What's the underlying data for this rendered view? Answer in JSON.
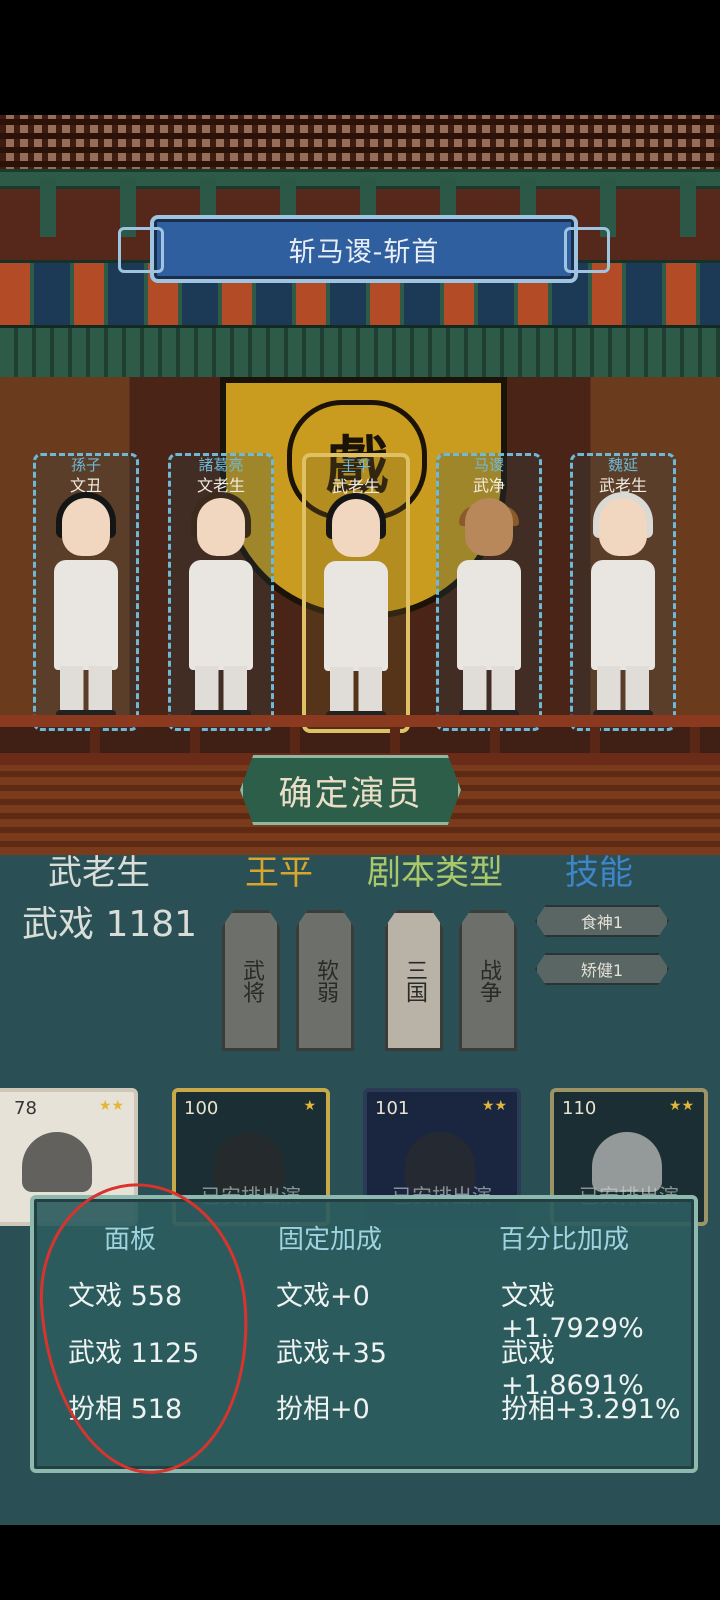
{
  "play_title": "斩马谡-斩首",
  "stage_sign": "戲",
  "actors": [
    {
      "name": "孫子",
      "role": "文丑",
      "selected": false
    },
    {
      "name": "諸葛亮",
      "role": "文老生",
      "selected": false
    },
    {
      "name": "王平",
      "role": "武老生",
      "selected": true
    },
    {
      "name": "马谡",
      "role": "武净",
      "selected": false
    },
    {
      "name": "魏延",
      "role": "武老生",
      "selected": false
    }
  ],
  "confirm_button": "确定演员",
  "info": {
    "role_type": "武老生",
    "actor_name": "王平",
    "script_type_label": "剧本类型",
    "skill_label": "技能",
    "stat_line": "武戏 1181",
    "traits": [
      "武将",
      "软弱"
    ],
    "script_tags": [
      "三国",
      "战争"
    ],
    "skills": [
      "食神1",
      "矫健1"
    ]
  },
  "cards": [
    {
      "level": "78",
      "stars": "★★",
      "note": ""
    },
    {
      "level": "100",
      "stars": "★",
      "note": "已安排出演"
    },
    {
      "level": "101",
      "stars": "★★",
      "note": "已安排出演"
    },
    {
      "level": "110",
      "stars": "★★",
      "note": "已安排出演"
    }
  ],
  "stats_panel": {
    "headers": [
      "面板",
      "固定加成",
      "百分比加成"
    ],
    "panel": [
      "文戏 558",
      "武戏 1125",
      "扮相 518"
    ],
    "fixed": [
      "文戏+0",
      "武戏+35",
      "扮相+0"
    ],
    "percent": [
      "文戏+1.7929%",
      "武戏+1.8691%",
      "扮相+3.291%"
    ]
  },
  "colors": {
    "highlight": "#d8a62a",
    "script": "#a9c86a",
    "skill": "#3f86c9",
    "annotation": "#d8342d"
  }
}
